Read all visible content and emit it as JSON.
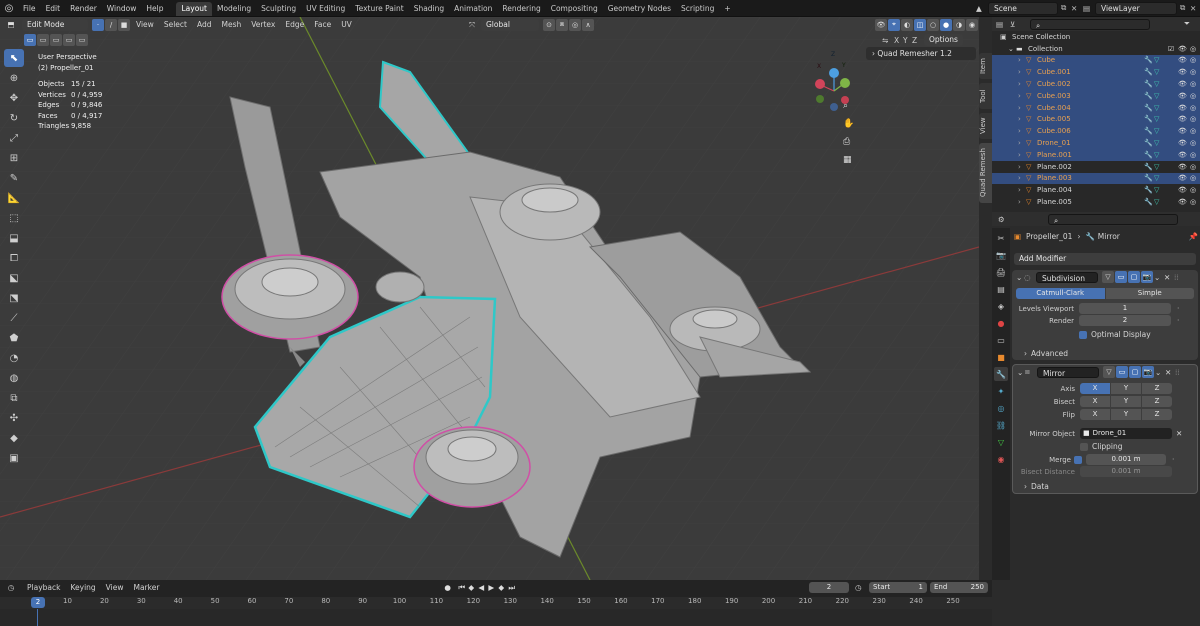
{
  "colors": {
    "accent": "#4772b3",
    "selected_orange": "#e8862a",
    "mesh_cyan": "#2fc8c8",
    "viewport_bg": "#3b3b3b"
  },
  "menu": [
    "File",
    "Edit",
    "Render",
    "Window",
    "Help"
  ],
  "workspaces": [
    {
      "label": "Layout",
      "active": true
    },
    {
      "label": "Modeling"
    },
    {
      "label": "Sculpting"
    },
    {
      "label": "UV Editing"
    },
    {
      "label": "Texture Paint"
    },
    {
      "label": "Shading"
    },
    {
      "label": "Animation"
    },
    {
      "label": "Rendering"
    },
    {
      "label": "Compositing"
    },
    {
      "label": "Geometry Nodes"
    },
    {
      "label": "Scripting"
    }
  ],
  "add_workspace": "+",
  "scene": "Scene",
  "view_layer": "ViewLayer",
  "viewport": {
    "mode": "Edit Mode",
    "menus": [
      "View",
      "Select",
      "Add",
      "Mesh",
      "Vertex",
      "Edge",
      "Face",
      "UV"
    ],
    "orientation": "Global",
    "options": "Options",
    "view_name": "User Perspective",
    "object_name": "(2) Propeller_01",
    "stats": [
      {
        "k": "Objects",
        "v": "15 / 21"
      },
      {
        "k": "Vertices",
        "v": "0 / 4,959"
      },
      {
        "k": "Edges",
        "v": "0 / 9,846"
      },
      {
        "k": "Faces",
        "v": "0 / 4,917"
      },
      {
        "k": "Triangles",
        "v": "9,858"
      }
    ],
    "xyz": [
      "X",
      "Y",
      "Z"
    ],
    "gizmo": {
      "x": "X",
      "y": "Y",
      "z": "Z"
    },
    "addon_panel": "Quad Remesher 1.2"
  },
  "side_tabs": [
    "Item",
    "Tool",
    "View",
    "Quad Remesh"
  ],
  "outliner": {
    "title": "Scene Collection",
    "collection": "Collection",
    "items": [
      {
        "name": "Cube",
        "sel": true
      },
      {
        "name": "Cube.001",
        "sel": true
      },
      {
        "name": "Cube.002",
        "sel": true
      },
      {
        "name": "Cube.003",
        "sel": true
      },
      {
        "name": "Cube.004",
        "sel": true
      },
      {
        "name": "Cube.005",
        "sel": true
      },
      {
        "name": "Cube.006",
        "sel": true
      },
      {
        "name": "Drone_01",
        "sel": true
      },
      {
        "name": "Plane.001",
        "sel": true
      },
      {
        "name": "Plane.002",
        "sel": false
      },
      {
        "name": "Plane.003",
        "sel": true
      },
      {
        "name": "Plane.004",
        "sel": false
      },
      {
        "name": "Plane.005",
        "sel": false
      }
    ]
  },
  "properties": {
    "breadcrumb_object": "Propeller_01",
    "breadcrumb_modifier": "Mirror",
    "add_modifier": "Add Modifier",
    "subdivision": {
      "name": "Subdivision",
      "mode_a": "Catmull-Clark",
      "mode_b": "Simple",
      "levels_label": "Levels Viewport",
      "levels": "1",
      "render_label": "Render",
      "render": "2",
      "optimal": "Optimal Display",
      "advanced": "Advanced"
    },
    "mirror": {
      "name": "Mirror",
      "axis_label": "Axis",
      "bisect_label": "Bisect",
      "flip_label": "Flip",
      "mirror_object_label": "Mirror Object",
      "mirror_object": "Drone_01",
      "clipping": "Clipping",
      "merge_label": "Merge",
      "merge": "0.001 m",
      "bisect_distance_label": "Bisect Distance",
      "bisect_distance": "0.001 m",
      "data": "Data"
    }
  },
  "timeline": {
    "menus": [
      "Playback",
      "Keying",
      "View",
      "Marker"
    ],
    "current_frame": "2",
    "start_label": "Start",
    "start": "1",
    "end_label": "End",
    "end": "250",
    "ruler": [
      {
        "f": "2"
      },
      {
        "f": "10"
      },
      {
        "f": "20"
      },
      {
        "f": "30"
      },
      {
        "f": "40"
      },
      {
        "f": "50"
      },
      {
        "f": "60"
      },
      {
        "f": "70"
      },
      {
        "f": "80"
      },
      {
        "f": "90"
      },
      {
        "f": "100"
      },
      {
        "f": "110"
      },
      {
        "f": "120"
      },
      {
        "f": "130"
      },
      {
        "f": "140"
      },
      {
        "f": "150"
      },
      {
        "f": "160"
      },
      {
        "f": "170"
      },
      {
        "f": "180"
      },
      {
        "f": "190"
      },
      {
        "f": "200"
      },
      {
        "f": "210"
      },
      {
        "f": "220"
      },
      {
        "f": "230"
      },
      {
        "f": "240"
      },
      {
        "f": "250"
      }
    ]
  }
}
